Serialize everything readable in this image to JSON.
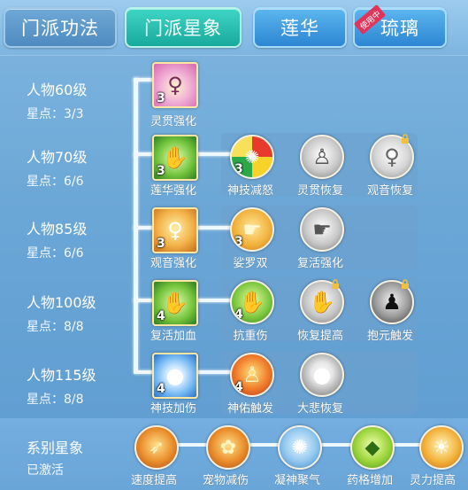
{
  "tabs": [
    {
      "label": "门派功法"
    },
    {
      "label": "门派星象"
    },
    {
      "label": "莲华"
    },
    {
      "label": "琉璃"
    }
  ],
  "tab_badge": "使用中",
  "levels": [
    {
      "title": "人物60级",
      "stars": "星点：3/3"
    },
    {
      "title": "人物70级",
      "stars": "星点：6/6"
    },
    {
      "title": "人物85级",
      "stars": "星点：6/6"
    },
    {
      "title": "人物100级",
      "stars": "星点：8/8"
    },
    {
      "title": "人物115级",
      "stars": "星点：8/8"
    }
  ],
  "skills": {
    "r1": [
      {
        "name": "灵贯强化",
        "count": "3"
      }
    ],
    "r2": [
      {
        "name": "莲华强化",
        "count": "3"
      },
      {
        "name": "神技减怒",
        "count": "3"
      },
      {
        "name": "灵贯恢复",
        "count": ""
      },
      {
        "name": "观音恢复",
        "count": ""
      }
    ],
    "r3": [
      {
        "name": "观音强化",
        "count": "3"
      },
      {
        "name": "娑罗双",
        "count": "3"
      },
      {
        "name": "复活强化",
        "count": ""
      }
    ],
    "r4": [
      {
        "name": "复活加血",
        "count": "4"
      },
      {
        "name": "抗重伤",
        "count": "4"
      },
      {
        "name": "恢复提高",
        "count": ""
      },
      {
        "name": "抱元触发",
        "count": ""
      }
    ],
    "r5": [
      {
        "name": "神技加伤",
        "count": "4"
      },
      {
        "name": "神佑触发",
        "count": "4"
      },
      {
        "name": "大悲恢复",
        "count": ""
      }
    ]
  },
  "series": {
    "title": "系别星象",
    "status": "已激活",
    "items": [
      {
        "name": "速度提高"
      },
      {
        "name": "宠物减伤"
      },
      {
        "name": "凝神聚气"
      },
      {
        "name": "药格增加"
      },
      {
        "name": "灵力提高"
      }
    ]
  },
  "icons": {
    "lock": "lock-icon"
  }
}
